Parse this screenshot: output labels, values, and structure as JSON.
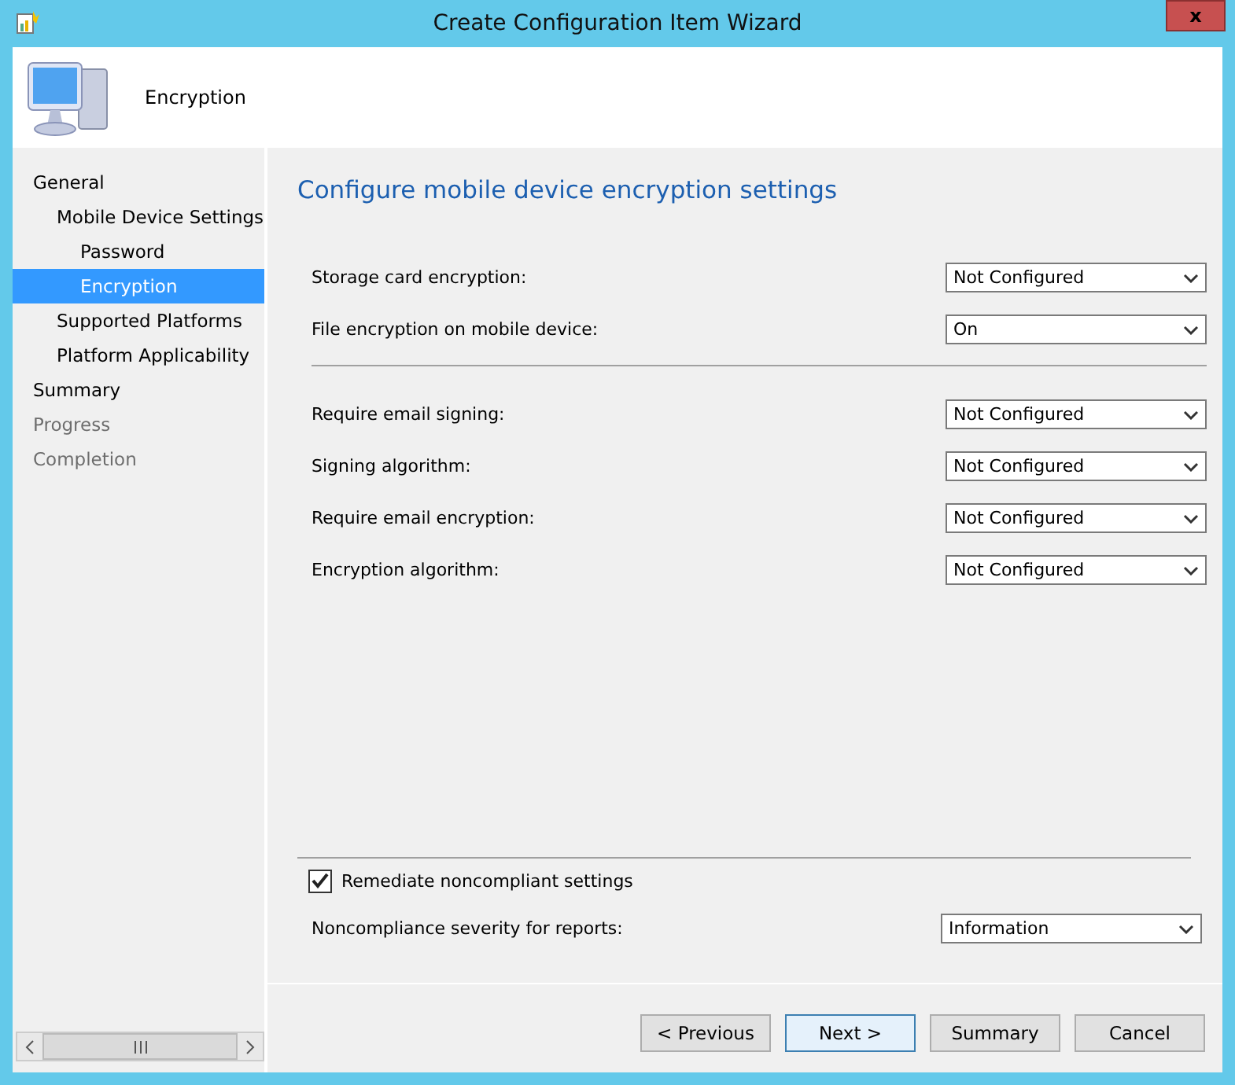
{
  "window": {
    "title": "Create Configuration Item Wizard",
    "close": "x"
  },
  "header": {
    "title": "Encryption"
  },
  "nav": [
    {
      "label": "General",
      "selected": false,
      "disabled": false,
      "children": [
        {
          "label": "Mobile Device Settings",
          "selected": false,
          "disabled": false,
          "children": [
            {
              "label": "Password",
              "selected": false,
              "disabled": false
            },
            {
              "label": "Encryption",
              "selected": true,
              "disabled": false
            }
          ]
        },
        {
          "label": "Supported Platforms",
          "selected": false,
          "disabled": false
        },
        {
          "label": "Platform Applicability",
          "selected": false,
          "disabled": false
        }
      ]
    },
    {
      "label": "Summary",
      "selected": false,
      "disabled": false
    },
    {
      "label": "Progress",
      "selected": false,
      "disabled": true
    },
    {
      "label": "Completion",
      "selected": false,
      "disabled": true
    }
  ],
  "page_title": "Configure mobile device encryption settings",
  "setting_groups": [
    [
      {
        "label": "Storage card encryption:",
        "value": "Not Configured"
      },
      {
        "label": "File encryption on mobile device:",
        "value": "On"
      }
    ],
    [
      {
        "label": "Require email signing:",
        "value": "Not Configured"
      },
      {
        "label": "Signing algorithm:",
        "value": "Not Configured"
      },
      {
        "label": "Require email encryption:",
        "value": "Not Configured"
      },
      {
        "label": "Encryption algorithm:",
        "value": "Not Configured"
      }
    ]
  ],
  "remediate": {
    "label": "Remediate noncompliant settings",
    "checked": true
  },
  "severity": {
    "label": "Noncompliance severity for reports:",
    "value": "Information"
  },
  "buttons": [
    {
      "label": "< Previous",
      "selected": false
    },
    {
      "label": "Next >",
      "selected": true
    },
    {
      "label": "Summary",
      "selected": false
    },
    {
      "label": "Cancel",
      "selected": false
    }
  ]
}
